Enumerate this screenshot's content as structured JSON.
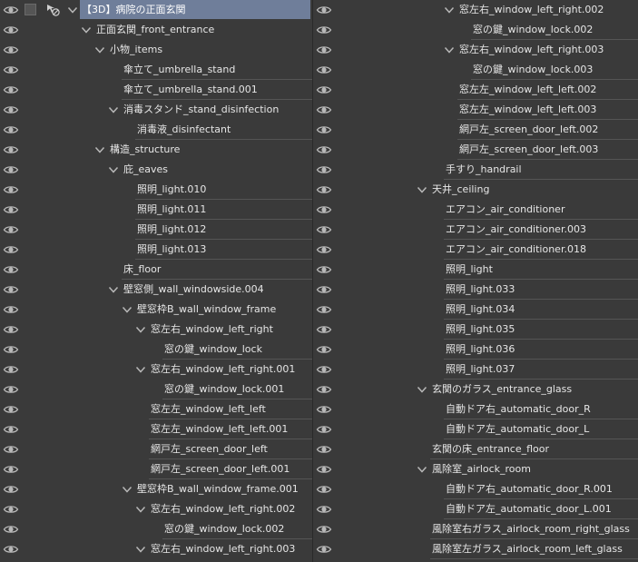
{
  "left_column": [
    {
      "label": "【3D】病院の正面玄関",
      "depth": 0,
      "expanded": true,
      "selected": true
    },
    {
      "label": "正面玄関_front_entrance",
      "depth": 1,
      "expanded": true
    },
    {
      "label": "小物_items",
      "depth": 2,
      "expanded": true
    },
    {
      "label": "傘立て_umbrella_stand",
      "depth": 3
    },
    {
      "label": "傘立て_umbrella_stand.001",
      "depth": 3
    },
    {
      "label": "消毒スタンド_stand_disinfection",
      "depth": 3,
      "expanded": true
    },
    {
      "label": "消毒液_disinfectant",
      "depth": 4
    },
    {
      "label": "構造_structure",
      "depth": 2,
      "expanded": true
    },
    {
      "label": "庇_eaves",
      "depth": 3,
      "expanded": true
    },
    {
      "label": "照明_light.010",
      "depth": 4
    },
    {
      "label": "照明_light.011",
      "depth": 4
    },
    {
      "label": "照明_light.012",
      "depth": 4
    },
    {
      "label": "照明_light.013",
      "depth": 4
    },
    {
      "label": "床_floor",
      "depth": 3
    },
    {
      "label": "壁窓側_wall_windowside.004",
      "depth": 3,
      "expanded": true
    },
    {
      "label": "壁窓枠B_wall_window_frame",
      "depth": 4,
      "expanded": true
    },
    {
      "label": "窓左右_window_left_right",
      "depth": 5,
      "expanded": true
    },
    {
      "label": "窓の鍵_window_lock",
      "depth": 6
    },
    {
      "label": "窓左右_window_left_right.001",
      "depth": 5,
      "expanded": true
    },
    {
      "label": "窓の鍵_window_lock.001",
      "depth": 6
    },
    {
      "label": "窓左左_window_left_left",
      "depth": 5
    },
    {
      "label": "窓左左_window_left_left.001",
      "depth": 5
    },
    {
      "label": "網戸左_screen_door_left",
      "depth": 5
    },
    {
      "label": "網戸左_screen_door_left.001",
      "depth": 5
    },
    {
      "label": "壁窓枠B_wall_window_frame.001",
      "depth": 4,
      "expanded": true
    },
    {
      "label": "窓左右_window_left_right.002",
      "depth": 5,
      "expanded": true
    },
    {
      "label": "窓の鍵_window_lock.002",
      "depth": 6
    },
    {
      "label": "窓左右_window_left_right.003",
      "depth": 5,
      "expanded": true
    }
  ],
  "right_column": [
    {
      "label": "窓左右_window_left_right.002",
      "depth": 1,
      "expanded": true
    },
    {
      "label": "窓の鍵_window_lock.002",
      "depth": 2
    },
    {
      "label": "窓左右_window_left_right.003",
      "depth": 1,
      "expanded": true
    },
    {
      "label": "窓の鍵_window_lock.003",
      "depth": 2
    },
    {
      "label": "窓左左_window_left_left.002",
      "depth": 1
    },
    {
      "label": "窓左左_window_left_left.003",
      "depth": 1
    },
    {
      "label": "網戸左_screen_door_left.002",
      "depth": 1
    },
    {
      "label": "網戸左_screen_door_left.003",
      "depth": 1
    },
    {
      "label": "手すり_handrail",
      "depth": 0
    },
    {
      "label": "天井_ceiling",
      "depth": -1,
      "expanded": true
    },
    {
      "label": "エアコン_air_conditioner",
      "depth": 0
    },
    {
      "label": "エアコン_air_conditioner.003",
      "depth": 0
    },
    {
      "label": "エアコン_air_conditioner.018",
      "depth": 0
    },
    {
      "label": "照明_light",
      "depth": 0
    },
    {
      "label": "照明_light.033",
      "depth": 0
    },
    {
      "label": "照明_light.034",
      "depth": 0
    },
    {
      "label": "照明_light.035",
      "depth": 0
    },
    {
      "label": "照明_light.036",
      "depth": 0
    },
    {
      "label": "照明_light.037",
      "depth": 0
    },
    {
      "label": "玄関のガラス_entrance_glass",
      "depth": -1,
      "expanded": true
    },
    {
      "label": "自動ドア右_automatic_door_R",
      "depth": 0
    },
    {
      "label": "自動ドア左_automatic_door_L",
      "depth": 0
    },
    {
      "label": "玄関の床_entrance_floor",
      "depth": -1
    },
    {
      "label": "風除室_airlock_room",
      "depth": -1,
      "expanded": true
    },
    {
      "label": "自動ドア右_automatic_door_R.001",
      "depth": 0
    },
    {
      "label": "自動ドア左_automatic_door_L.001",
      "depth": 0
    },
    {
      "label": "風除室右ガラス_airlock_room_right_glass",
      "depth": -1
    },
    {
      "label": "風除室左ガラス_airlock_room_left_glass",
      "depth": -1
    }
  ],
  "icons": {
    "visibility": "eye-icon",
    "expand": "chevron-down-icon",
    "lock": "lock-slash-icon",
    "checkbox": "checkbox"
  },
  "colors": {
    "background": "#3a3a3a",
    "selected": "#6f7e9a",
    "text": "#e6e6e6",
    "separator": "#555555",
    "icon": "#b8b8b8"
  }
}
